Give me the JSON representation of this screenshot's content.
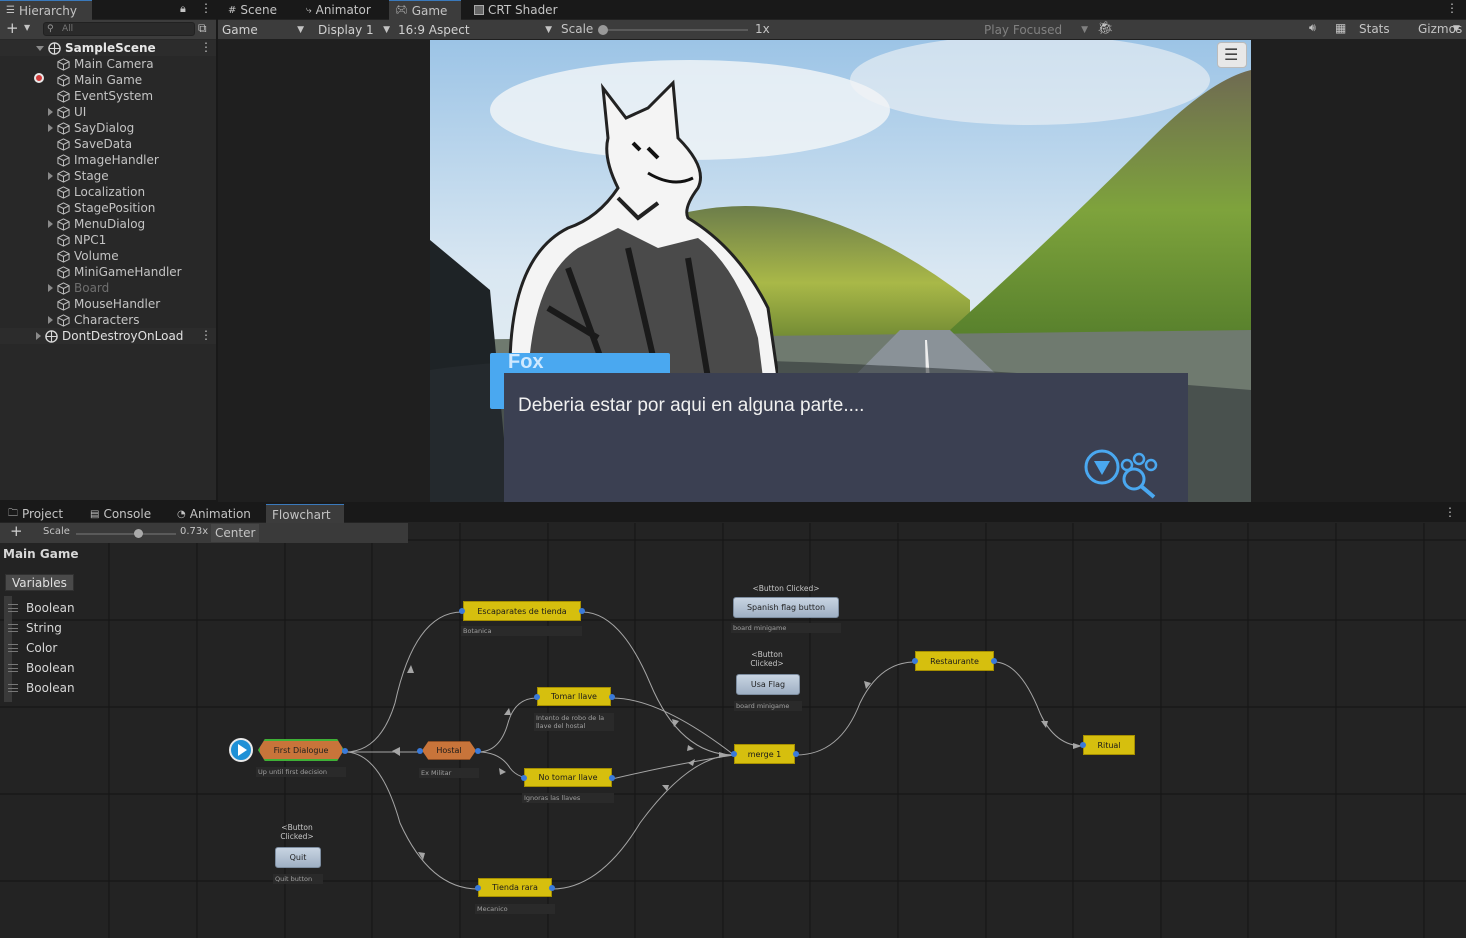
{
  "hierarchy": {
    "tab_label": "Hierarchy",
    "search_placeholder": "All",
    "scene": "SampleScene",
    "items": [
      "Main Camera",
      "Main Game",
      "EventSystem",
      "UI",
      "SayDialog",
      "SaveData",
      "ImageHandler",
      "Stage",
      "Localization",
      "StagePosition",
      "MenuDialog",
      "NPC1",
      "Volume",
      "MiniGameHandler",
      "Board",
      "MouseHandler",
      "Characters"
    ],
    "dont_destroy": "DontDestroyOnLoad"
  },
  "top_tabs": [
    "Scene",
    "Animator",
    "Game",
    "CRT Shader"
  ],
  "game_toolbar": {
    "display_mode": "Game",
    "display": "Display 1",
    "aspect": "16:9 Aspect",
    "scale_label": "Scale",
    "scale_value": "1x",
    "play_mode": "Play Focused",
    "stats": "Stats",
    "gizmos": "Gizmos"
  },
  "game_view": {
    "speaker": "Fox",
    "dialog": "Deberia estar por aqui en alguna parte...."
  },
  "bottom_tabs": [
    "Project",
    "Console",
    "Animation",
    "Flowchart"
  ],
  "flowchart": {
    "scale_label": "Scale",
    "scale_value": "0.73x",
    "center_label": "Center",
    "title": "Main Game",
    "variables_button": "Variables",
    "variables": [
      "Boolean",
      "String",
      "Color",
      "Boolean",
      "Boolean"
    ],
    "nodes": {
      "first_dialogue": {
        "label": "First Dialogue",
        "desc": "Up until first decision"
      },
      "hostal": {
        "label": "Hostal",
        "desc": "Ex Militar"
      },
      "escaparates": {
        "label": "Escaparates de tienda",
        "desc": "Botanica"
      },
      "tomar_llave": {
        "label": "Tomar llave",
        "desc": "Intento de robo de la llave del hostal"
      },
      "no_tomar": {
        "label": "No tomar llave",
        "desc": "Ignoras las llaves"
      },
      "tienda_rara": {
        "label": "Tienda rara",
        "desc": "Mecanico"
      },
      "merge": {
        "label": "merge 1"
      },
      "restaurante": {
        "label": "Restaurante"
      },
      "ritual": {
        "label": "Ritual"
      },
      "spanish_flag": {
        "caption": "<Button Clicked>",
        "label": "Spanish flag button",
        "desc": "board minigame"
      },
      "usa_flag": {
        "caption": "<Button Clicked>",
        "label": "Usa Flag",
        "desc": "board minigame"
      },
      "quit": {
        "caption": "<Button Clicked>",
        "label": "Quit",
        "desc": "Quit button"
      }
    }
  },
  "colors": {
    "accent": "#3a79bb",
    "block_yellow": "#d6bf0e",
    "block_orange": "#c8743a",
    "start_green": "#3fb037",
    "dialog_bg": "#3b4052",
    "speaker_blue": "#4aa8f0"
  }
}
